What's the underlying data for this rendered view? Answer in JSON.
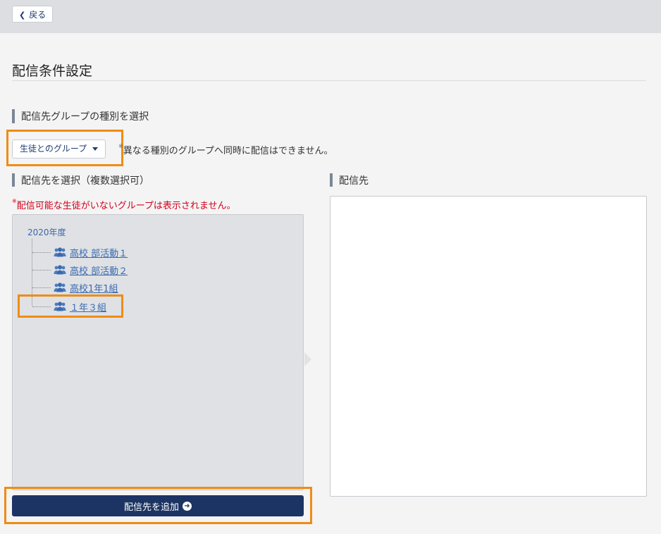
{
  "topbar": {
    "back_label": "戻る"
  },
  "page": {
    "title": "配信条件設定"
  },
  "group_type": {
    "heading": "配信先グループの種別を選択",
    "selected": "生徒とのグループ",
    "note_mark": "※",
    "note": "異なる種別のグループへ同時に配信はできません。"
  },
  "select": {
    "heading": "配信先を選択（複数選択可）",
    "warn_mark": "※",
    "warning": "配信可能な生徒がいないグループは表示されません。",
    "tree": {
      "root": "2020年度",
      "items": [
        {
          "label": "高校 部活動１",
          "icon": "group-icon"
        },
        {
          "label": "高校 部活動２",
          "icon": "group-icon"
        },
        {
          "label": "高校1年1組",
          "icon": "group-icon"
        },
        {
          "label": "１年３組",
          "icon": "group-icon"
        }
      ]
    },
    "add_button": "配信先を追加"
  },
  "destination": {
    "heading": "配信先"
  },
  "colors": {
    "accent": "#1c3463",
    "highlight": "#ef8c14",
    "warning": "#d0021b",
    "link": "#3a6aae"
  }
}
